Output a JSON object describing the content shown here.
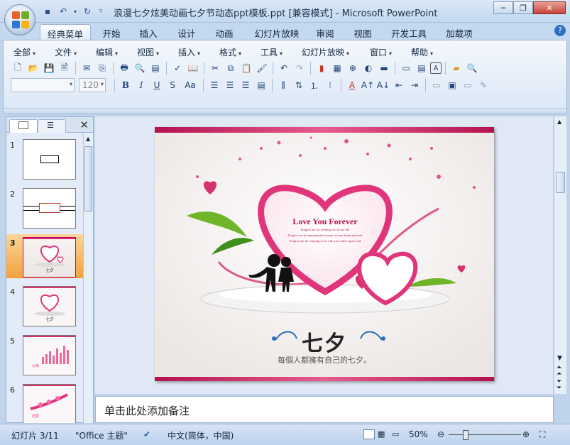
{
  "window": {
    "title": "浪漫七夕炫美动画七夕节动态ppt模板.ppt [兼容模式] - Microsoft PowerPoint"
  },
  "ribbon_tabs": [
    "经典菜单",
    "开始",
    "插入",
    "设计",
    "动画",
    "幻灯片放映",
    "审阅",
    "视图",
    "开发工具",
    "加载项"
  ],
  "classic_menu": [
    "全部",
    "文件",
    "编辑",
    "视图",
    "插入",
    "格式",
    "工具",
    "幻灯片放映",
    "窗口",
    "帮助"
  ],
  "font_size_value": "120",
  "format_buttons": {
    "bold": "B",
    "italic": "I",
    "underline": "U",
    "shadow": "S",
    "change_case": "Aa",
    "font_color": "A",
    "text_box": "A"
  },
  "thumbnails": [
    {
      "num": "1"
    },
    {
      "num": "2"
    },
    {
      "num": "3",
      "selected": true
    },
    {
      "num": "4"
    },
    {
      "num": "5"
    },
    {
      "num": "6"
    }
  ],
  "slide": {
    "heart_title": "Love You Forever",
    "heart_lines": [
      "Forgive me for sending you to my life",
      "Forgive me for enjoying the beauty of your body and soul",
      "Forgive me for wanting to be with you when I grow old"
    ],
    "logo_text": "七夕",
    "tagline": "每個人都擁有自己的七夕。"
  },
  "notes_placeholder": "单击此处添加备注",
  "status": {
    "slide_info": "幻灯片 3/11",
    "theme": "\"Office 主题\"",
    "language": "中文(简体，中国)",
    "zoom": "50%"
  },
  "colors": {
    "accent_pink": "#d8326e",
    "frame_gradient_top": "#dbe8f7",
    "selected_thumb": "#f2a23d"
  }
}
